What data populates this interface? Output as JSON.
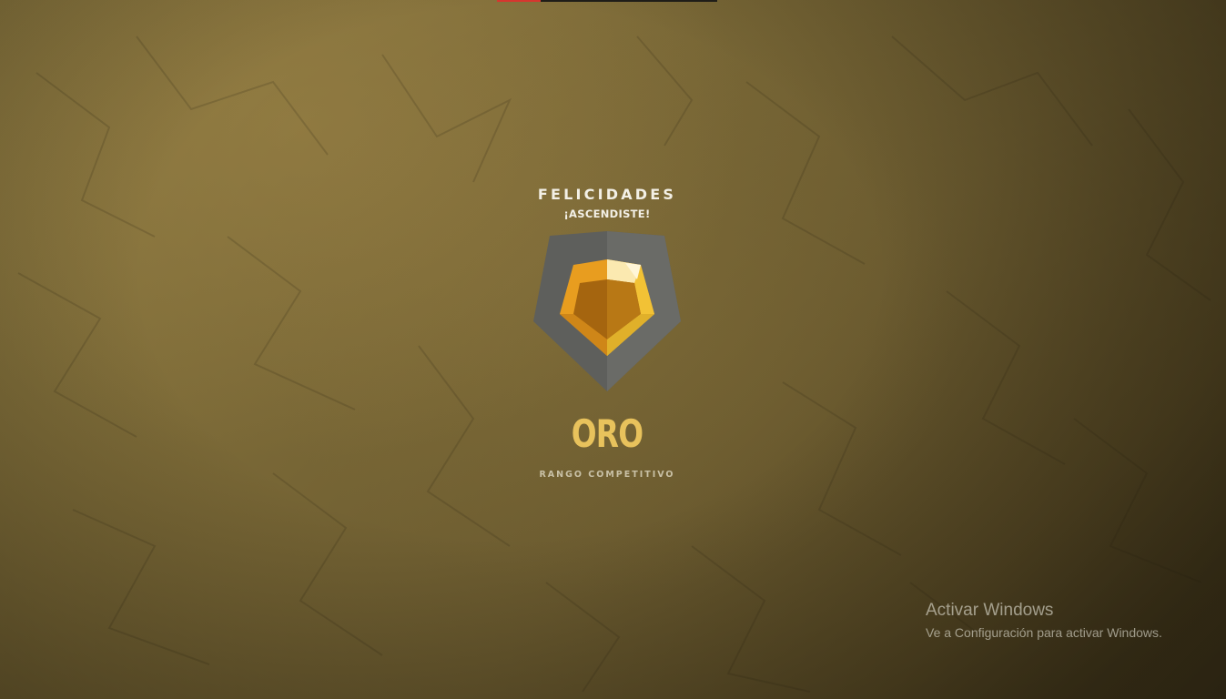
{
  "progress": {
    "fraction": 0.2,
    "fill_color": "#d6362f"
  },
  "promotion": {
    "title": "FELICIDADES",
    "subtitle": "¡ASCENDISTE!"
  },
  "rank": {
    "name": "ORO",
    "caption": "RANGO COMPETITIVO",
    "icon": "gold-rank-badge-icon",
    "color": "#e8c25c"
  },
  "watermark": {
    "title": "Activar Windows",
    "subtitle": "Ve a Configuración para activar Windows."
  }
}
